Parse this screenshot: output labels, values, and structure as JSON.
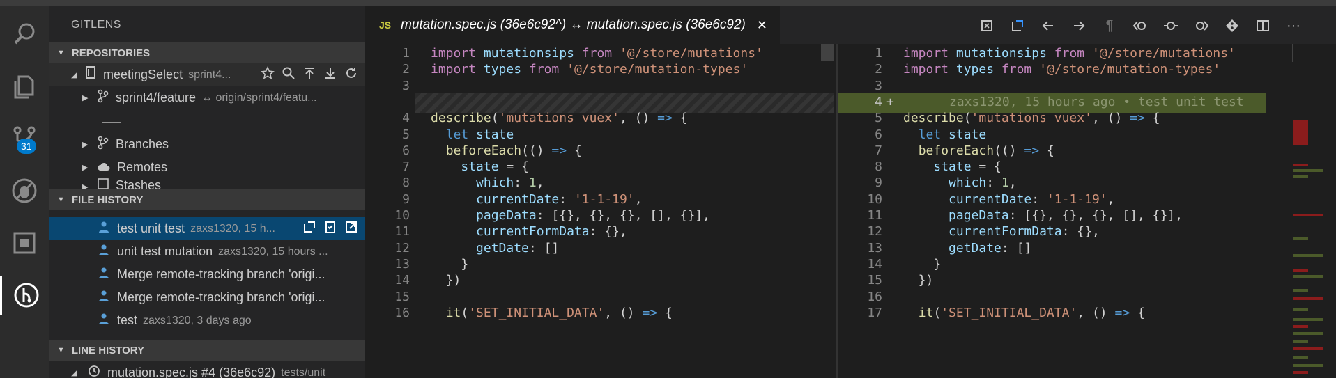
{
  "sidebar": {
    "title": "GITLENS",
    "repositories_header": "REPOSITORIES",
    "repo": {
      "name": "meetingSelect",
      "branch_hint": "sprint4..."
    },
    "branch_row": {
      "label": "sprint4/feature",
      "tracking": "↔ origin/sprint4/featu..."
    },
    "separator_text": "——",
    "branches_label": "Branches",
    "remotes_label": "Remotes",
    "stashes_label": "Stashes",
    "file_history_header": "FILE HISTORY",
    "history": [
      {
        "msg": "test unit test",
        "meta": "zaxs1320, 15 h..."
      },
      {
        "msg": "unit test mutation",
        "meta": "zaxs1320, 15 hours ..."
      },
      {
        "msg": "Merge remote-tracking branch 'origi...",
        "meta": ""
      },
      {
        "msg": "Merge remote-tracking branch 'origi...",
        "meta": ""
      },
      {
        "msg": "test",
        "meta": "zaxs1320, 3 days ago"
      }
    ],
    "line_history_header": "LINE HISTORY",
    "line_history_row": {
      "label": "mutation.spec.js #4 (36e6c92)",
      "path": "tests/unit"
    }
  },
  "activity": {
    "badge": "31",
    "icons": [
      "search-icon",
      "explorer-icon",
      "source-control-icon",
      "debug-icon",
      "extensions-icon",
      "gitlens-icon"
    ]
  },
  "editor": {
    "tab": {
      "lang": "JS",
      "title": "mutation.spec.js (36e6c92^) ↔ mutation.spec.js (36e6c92)",
      "close": "✕"
    },
    "blame": "zaxs1320, 15 hours ago • test unit test",
    "left_numbers": [
      "1",
      "2",
      "3",
      "",
      "4",
      "5",
      "6",
      "7",
      "8",
      "9",
      "10",
      "11",
      "12",
      "13",
      "14",
      "15",
      "16"
    ],
    "right_numbers": [
      "1",
      "2",
      "3",
      "4",
      "5",
      "6",
      "7",
      "8",
      "9",
      "10",
      "11",
      "12",
      "13",
      "14",
      "15",
      "16",
      "17"
    ],
    "added_marker": "+"
  },
  "colors": {
    "accent": "#007acc",
    "selection": "#094771",
    "added": "#4b5a2a"
  }
}
